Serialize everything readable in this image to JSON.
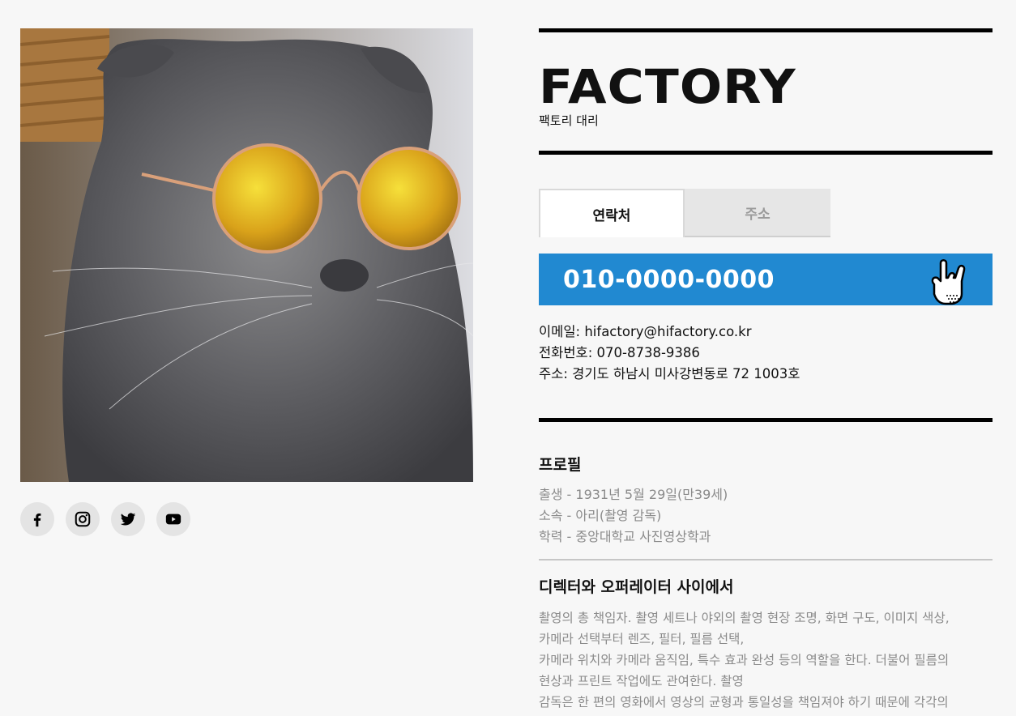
{
  "profile_image_alt": "cat wearing round mirrored sunglasses",
  "social": [
    {
      "name": "facebook-icon"
    },
    {
      "name": "instagram-icon"
    },
    {
      "name": "twitter-icon"
    },
    {
      "name": "youtube-icon"
    }
  ],
  "brand": {
    "title": "FACTORY",
    "subtitle": "팩토리 대리"
  },
  "tabs": [
    {
      "label": "연락처",
      "active": true
    },
    {
      "label": "주소",
      "active": false
    }
  ],
  "phone": {
    "number": "010-0000-0000",
    "color": "#2189d1"
  },
  "contact": {
    "email": "이메일: hifactory@hifactory.co.kr",
    "tel": "전화번호: 070-8738-9386",
    "address": "주소: 경기도 하남시 미사강변동로 72 1003호"
  },
  "profile": {
    "title": "프로필",
    "items": [
      "출생 - 1931년 5월 29일(만39세)",
      "소속 - 아리(촬영 감독)",
      "학력 - 중앙대학교 사진영상학과"
    ]
  },
  "section": {
    "title": "디렉터와 오퍼레이터 사이에서",
    "body": "촬영의 총 책임자. 촬영 세트나 야외의 촬영 현장 조명, 화면 구도, 이미지 색상,\n카메라 선택부터 렌즈, 필터, 필름 선택,\n카메라 위치와 카메라 움직임, 특수 효과 완성 등의 역할을 한다. 더불어 필름의\n현상과 프린트 작업에도 관여한다. 촬영\n감독은 한 편의 영화에서 영상의 균형과 통일성을 책임져야 하기 때문에 각각의"
  }
}
